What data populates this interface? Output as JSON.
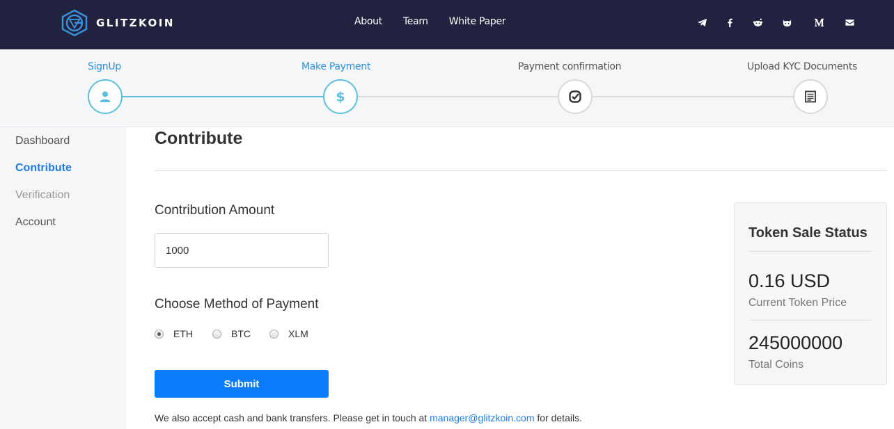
{
  "brand": {
    "name": "GLITZKOIN"
  },
  "nav": {
    "links": [
      "About",
      "Team",
      "White Paper"
    ],
    "social_icons": [
      "telegram-icon",
      "facebook-icon",
      "reddit-icon",
      "github-icon",
      "medium-icon",
      "email-icon"
    ]
  },
  "steps": [
    {
      "label": "SignUp",
      "icon": "user-icon",
      "state": "complete"
    },
    {
      "label": "Make Payment",
      "icon": "dollar-icon",
      "state": "current"
    },
    {
      "label": "Payment confirmation",
      "icon": "check-icon",
      "state": "pending"
    },
    {
      "label": "Upload KYC Documents",
      "icon": "document-icon",
      "state": "pending"
    }
  ],
  "sidebar": {
    "items": [
      {
        "label": "Dashboard",
        "state": "normal"
      },
      {
        "label": "Contribute",
        "state": "active"
      },
      {
        "label": "Verification",
        "state": "disabled"
      },
      {
        "label": "Account",
        "state": "normal"
      }
    ]
  },
  "main": {
    "title": "Contribute",
    "amount_label": "Contribution Amount",
    "amount_value": "1000",
    "payment_label": "Choose Method of Payment",
    "payment_options": [
      {
        "label": "ETH",
        "checked": true
      },
      {
        "label": "BTC",
        "checked": false
      },
      {
        "label": "XLM",
        "checked": false
      }
    ],
    "submit_label": "Submit",
    "note_prefix": "We also accept cash and bank transfers. Please get in touch at ",
    "note_email": "manager@glitzkoin.com",
    "note_suffix": " for details."
  },
  "token_sale": {
    "title": "Token Sale Status",
    "price_value": "0.16 USD",
    "price_caption": "Current Token Price",
    "coins_value": "245000000",
    "coins_caption": "Total Coins"
  },
  "colors": {
    "nav_bg": "#20223f",
    "accent": "#1e7be6",
    "step_active": "#5bc0de",
    "button": "#0a7cfc"
  }
}
